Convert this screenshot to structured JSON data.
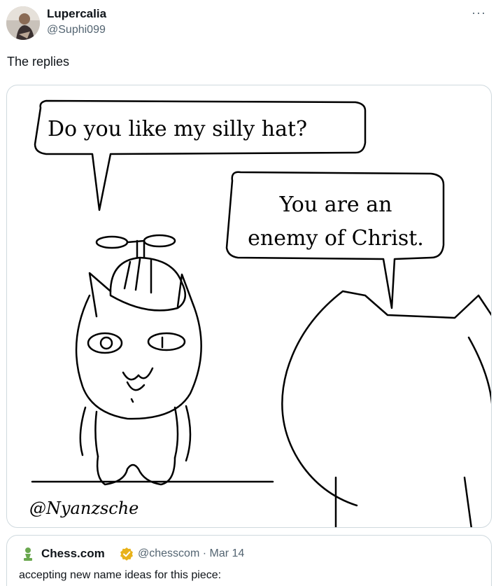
{
  "tweet": {
    "author_name": "Lupercalia",
    "author_handle": "@Suphi099",
    "more_icon": "more-options-icon",
    "text": "The replies"
  },
  "comic": {
    "bubble_left": "Do you like my silly hat?",
    "bubble_right_line1": "You are an",
    "bubble_right_line2": "enemy of Christ.",
    "signature": "@Nyanzsche"
  },
  "quote": {
    "author_name": "Chess.com",
    "author_handle": "@chesscom",
    "date": "Mar 14",
    "separator": "·",
    "text": "accepting new name ideas for this piece:",
    "verified_color": "#e8b21a",
    "icon_color": "#6aa84f"
  }
}
